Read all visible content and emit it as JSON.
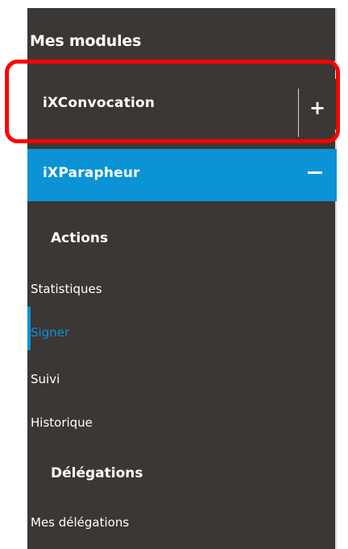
{
  "sidebar": {
    "title": "Mes modules",
    "modules": [
      {
        "label": "iXConvocation",
        "toggle": "+",
        "expanded": false
      },
      {
        "label": "iXParapheur",
        "toggle": "–",
        "expanded": true
      }
    ],
    "sections": [
      {
        "title": "Actions",
        "items": [
          "Statistiques",
          "Signer",
          "Suivi",
          "Historique"
        ],
        "selected": "Signer"
      },
      {
        "title": "Délégations",
        "items": [
          "Mes délégations"
        ]
      }
    ]
  },
  "colors": {
    "sidebar_bg": "#3b3735",
    "active_bg": "#0b93d5",
    "selected_text": "#0b93d5",
    "highlight": "#ff0000",
    "text": "#ffffff"
  }
}
